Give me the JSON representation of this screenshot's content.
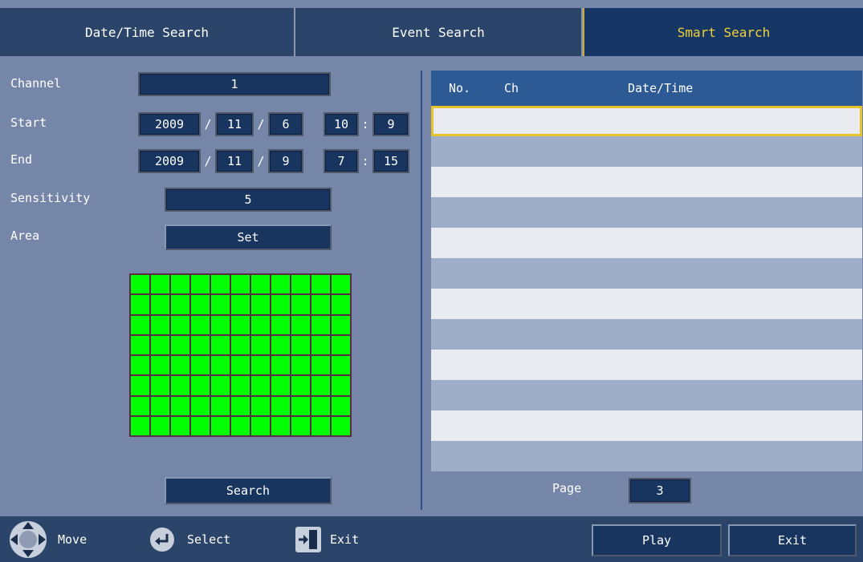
{
  "tabs": [
    "Date/Time Search",
    "Event Search",
    "Smart Search"
  ],
  "form": {
    "channel_label": "Channel",
    "channel_value": "1",
    "start_label": "Start",
    "start": {
      "year": "2009",
      "month": "11",
      "day": "6",
      "hour": "10",
      "minute": "9"
    },
    "end_label": "End",
    "end": {
      "year": "2009",
      "month": "11",
      "day": "9",
      "hour": "7",
      "minute": "15"
    },
    "date_sep": "/",
    "time_sep": ":",
    "sensitivity_label": "Sensitivity",
    "sensitivity_value": "5",
    "area_label": "Area",
    "area_button": "Set",
    "search_button": "Search"
  },
  "area_grid": {
    "cols": 11,
    "rows": 8,
    "active_color": "#00ff00"
  },
  "results": {
    "col_no": "No.",
    "col_ch": "Ch",
    "col_datetime": "Date/Time",
    "page_label": "Page",
    "page_value": "3"
  },
  "footer": {
    "move": "Move",
    "select": "Select",
    "exit_hint": "Exit",
    "play_button": "Play",
    "exit_button": "Exit"
  },
  "colors": {
    "accent": "#f2d23a",
    "panel": "#7586a8",
    "field": "#17355e"
  }
}
